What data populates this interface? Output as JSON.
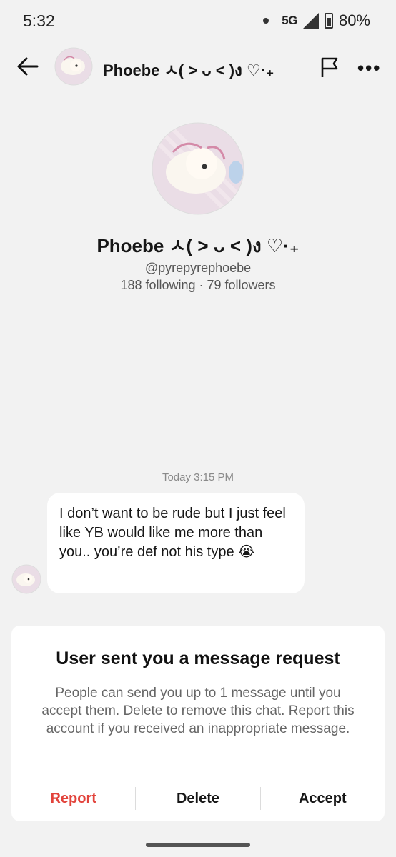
{
  "status_bar": {
    "time": "5:32",
    "network": "5G",
    "battery": "80%"
  },
  "header": {
    "title": "Phoebe ㅅ( ˃ ᴗ ˂ )ง ♡·₊"
  },
  "profile": {
    "name": "Phoebe ㅅ( ˃ ᴗ ˂ )ง ♡·₊",
    "handle": "@pyrepyrephoebe",
    "stats": "188 following · 79 followers"
  },
  "conversation": {
    "timestamp": "Today 3:15 PM",
    "messages": [
      {
        "text": "I don’t want to be rude but I just feel like YB would like me more than you.. you’re def not his type 😭"
      }
    ]
  },
  "request_card": {
    "title": "User sent you a message request",
    "body": "People can send you up to 1 message until you accept them. Delete to remove this chat. Report this account if you received an inappropriate message.",
    "report_label": "Report",
    "delete_label": "Delete",
    "accept_label": "Accept"
  },
  "colors": {
    "report": "#e2433b",
    "background": "#f2f2f2"
  },
  "icons": [
    "back-arrow-icon",
    "flag-icon",
    "more-icon",
    "signal-icon",
    "battery-icon"
  ]
}
